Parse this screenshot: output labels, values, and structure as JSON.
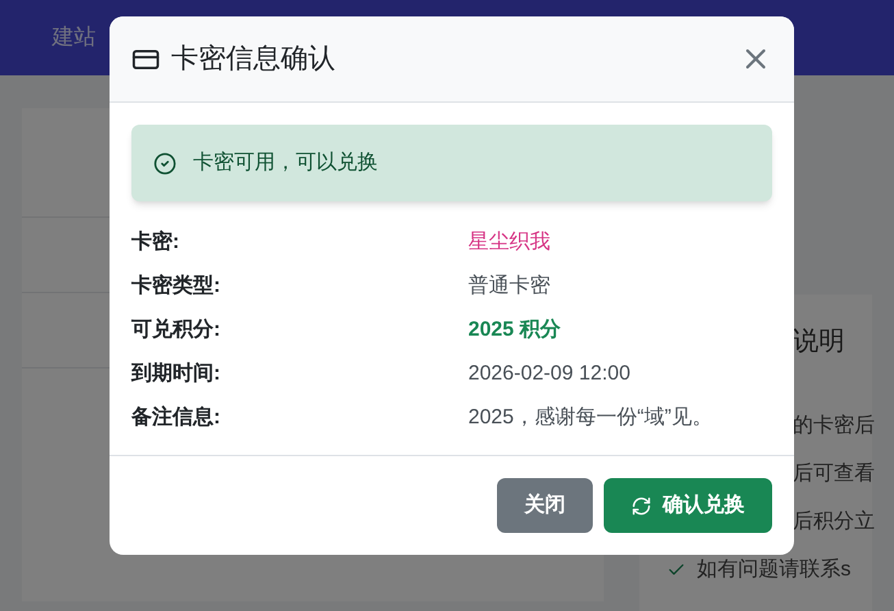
{
  "background": {
    "nav_items": [
      "建站"
    ],
    "panel_title": "说明",
    "panel_items": [
      {
        "text": "的卡密后",
        "kind": "cut"
      },
      {
        "text": "后可查看",
        "kind": "cut"
      },
      {
        "text": "后积分立",
        "kind": "cut"
      },
      {
        "text": "如有问题请联系s",
        "kind": "check"
      }
    ]
  },
  "dialog": {
    "title": "卡密信息确认",
    "alert": "卡密可用，可以兑换",
    "fields": [
      {
        "label": "卡密:",
        "value": "星尘织我",
        "kind": "code"
      },
      {
        "label": "卡密类型:",
        "value": "普通卡密",
        "kind": "plain"
      },
      {
        "label": "可兑积分:",
        "value": "2025 积分",
        "kind": "points"
      },
      {
        "label": "到期时间:",
        "value": "2026-02-09 12:00",
        "kind": "plain"
      },
      {
        "label": "备注信息:",
        "value": "2025，感谢每一份“域”见。",
        "kind": "plain"
      }
    ],
    "buttons": [
      {
        "label": "关闭",
        "kind": "secondary"
      },
      {
        "label": "确认兑换",
        "kind": "primary"
      }
    ]
  }
}
